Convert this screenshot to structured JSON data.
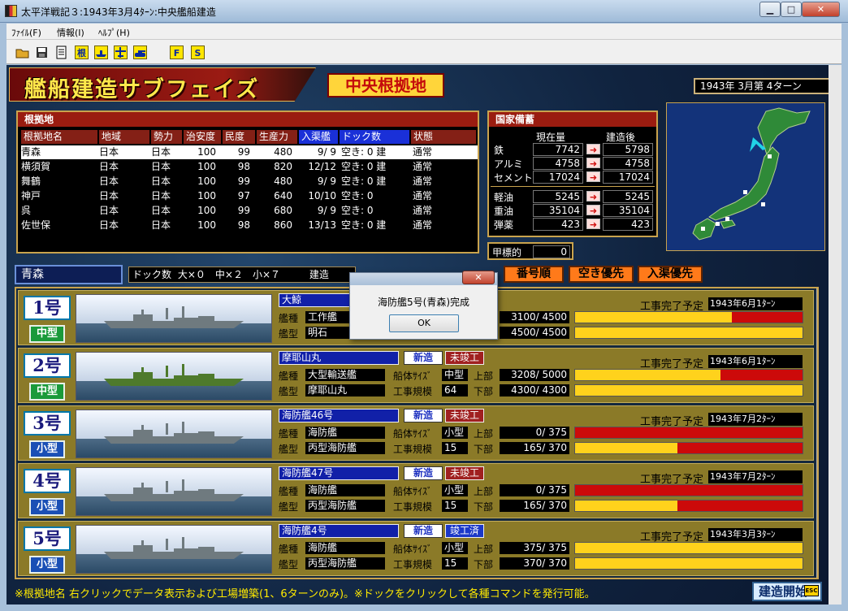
{
  "window": {
    "title": "太平洋戦記３:1943年3月4ﾀｰﾝ:中央艦船建造",
    "controls": {
      "minimize": "▁",
      "maximize": "□",
      "close": "✕"
    }
  },
  "menu": [
    "ﾌｧｲﾙ(F)",
    "情報(I)",
    "ﾍﾙﾌﾟ(H)"
  ],
  "toolbar": {
    "icons": [
      "open-folder-icon",
      "save-disk-icon",
      "document-icon",
      "base-icon",
      "ship-icon",
      "plane-icon",
      "tank-icon",
      "f-icon",
      "s-icon"
    ],
    "labels": {
      "base": "根",
      "f": "F",
      "s": "S"
    }
  },
  "header": {
    "title": "艦船建造サブフェイズ",
    "hq": "中央根拠地",
    "date": "1943年 3月第 4ターン"
  },
  "bases": {
    "title": "根拠地",
    "columns": [
      "根拠地名",
      "地域",
      "勢力",
      "治安度",
      "民度",
      "生産力",
      "入渠艦",
      "ドック数",
      "状態"
    ],
    "rows": [
      {
        "name": "青森",
        "region": "日本",
        "force": "日本",
        "security": "100",
        "civ": "99",
        "prod": "480",
        "dock_in": "9/ 9",
        "docks": "空き: 0 建",
        "state": "通常"
      },
      {
        "name": "横須賀",
        "region": "日本",
        "force": "日本",
        "security": "100",
        "civ": "98",
        "prod": "820",
        "dock_in": "12/12",
        "docks": "空き: 0 建",
        "state": "通常"
      },
      {
        "name": "舞鶴",
        "region": "日本",
        "force": "日本",
        "security": "100",
        "civ": "99",
        "prod": "480",
        "dock_in": "9/ 9",
        "docks": "空き: 0 建",
        "state": "通常"
      },
      {
        "name": "神戸",
        "region": "日本",
        "force": "日本",
        "security": "100",
        "civ": "97",
        "prod": "640",
        "dock_in": "10/10",
        "docks": "空き: 0",
        "state": "通常"
      },
      {
        "name": "呉",
        "region": "日本",
        "force": "日本",
        "security": "100",
        "civ": "99",
        "prod": "680",
        "dock_in": "9/ 9",
        "docks": "空き: 0",
        "state": "通常"
      },
      {
        "name": "佐世保",
        "region": "日本",
        "force": "日本",
        "security": "100",
        "civ": "98",
        "prod": "860",
        "dock_in": "13/13",
        "docks": "空き: 0 建",
        "state": "通常"
      }
    ]
  },
  "stores": {
    "title": "国家備蓄",
    "col_current": "現在量",
    "col_after": "建造後",
    "arrow": "➜",
    "group1": [
      {
        "label": "鉄",
        "current": "7742",
        "after": "5798"
      },
      {
        "label": "アルミ",
        "current": "4758",
        "after": "4758"
      },
      {
        "label": "セメント",
        "current": "17024",
        "after": "17024"
      }
    ],
    "group2": [
      {
        "label": "軽油",
        "current": "5245",
        "after": "5245"
      },
      {
        "label": "重油",
        "current": "35104",
        "after": "35104"
      },
      {
        "label": "弾薬",
        "current": "423",
        "after": "423"
      }
    ],
    "target_label": "甲標的",
    "target_value": "0"
  },
  "selection": {
    "base": "青森",
    "dock_count_label": "ドック数",
    "dock_count": "大×０　中×２　小×７",
    "build_label": "建造",
    "order_buttons": [
      "番号順",
      "空き優先",
      "入渠優先"
    ]
  },
  "dock_labels": {
    "type": "艦種",
    "model": "艦型",
    "hull": "船体ｻｲｽﾞ",
    "scale": "工事規模",
    "upper": "上部",
    "lower": "下部",
    "due": "工事完了予定"
  },
  "docks": [
    {
      "num": "1号",
      "size": "中型",
      "size_class": "mid",
      "ship_style": "grey-tender",
      "name": "大鯨",
      "new": "",
      "status": "",
      "type": "工作艦",
      "model": "明石",
      "hull": "",
      "scale": "",
      "upper": "3100/ 4500",
      "lower": "4500/ 4500",
      "upper_pct": 0.69,
      "lower_pct": 1.0,
      "due": "1943年6月1ﾀｰﾝ"
    },
    {
      "num": "2号",
      "size": "中型",
      "size_class": "mid",
      "ship_style": "green-transport",
      "name": "摩耶山丸",
      "new": "新造",
      "status": "未竣工",
      "type": "大型輸送艦",
      "model": "摩耶山丸",
      "hull": "中型",
      "scale": "64",
      "upper": "3208/ 5000",
      "lower": "4300/ 4300",
      "upper_pct": 0.64,
      "lower_pct": 1.0,
      "due": "1943年6月1ﾀｰﾝ"
    },
    {
      "num": "3号",
      "size": "小型",
      "size_class": "small",
      "ship_style": "grey-escort",
      "name": "海防艦46号",
      "new": "新造",
      "status": "未竣工",
      "type": "海防艦",
      "model": "丙型海防艦",
      "hull": "小型",
      "scale": "15",
      "upper": "0/ 375",
      "lower": "165/ 370",
      "upper_pct": 0.0,
      "lower_pct": 0.45,
      "due": "1943年7月2ﾀｰﾝ"
    },
    {
      "num": "4号",
      "size": "小型",
      "size_class": "small",
      "ship_style": "grey-escort",
      "name": "海防艦47号",
      "new": "新造",
      "status": "未竣工",
      "type": "海防艦",
      "model": "丙型海防艦",
      "hull": "小型",
      "scale": "15",
      "upper": "0/ 375",
      "lower": "165/ 370",
      "upper_pct": 0.0,
      "lower_pct": 0.45,
      "due": "1943年7月2ﾀｰﾝ"
    },
    {
      "num": "5号",
      "size": "小型",
      "size_class": "small",
      "ship_style": "grey-escort",
      "name": "海防艦4号",
      "new": "新造",
      "status": "竣工済",
      "type": "海防艦",
      "model": "丙型海防艦",
      "hull": "小型",
      "scale": "15",
      "upper": "375/ 375",
      "lower": "370/ 370",
      "upper_pct": 1.0,
      "lower_pct": 1.0,
      "due": "1943年3月3ﾀｰﾝ"
    }
  ],
  "footer": "※根拠地名 右クリックでデータ表示および工場増築(1、6ターンのみ)。※ドックをクリックして各種コマンドを発行可能。",
  "build_button": "建造開始",
  "esc_badge": "ESC",
  "dialog": {
    "message": "海防艦5号(青森)完成",
    "ok": "OK",
    "close": "✕"
  },
  "colors": {
    "accent_gold": "#c9a34d",
    "progress_done": "#ffd21c",
    "progress_remaining": "#cc0a0a",
    "header_red": "#9a1c10"
  }
}
